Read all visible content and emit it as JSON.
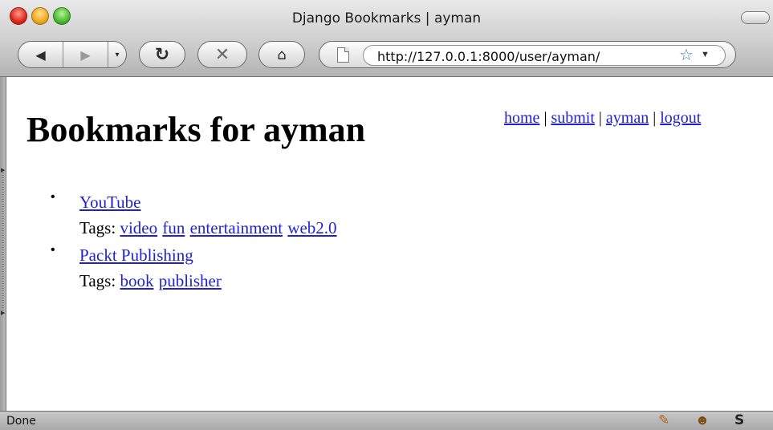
{
  "window": {
    "title": "Django Bookmarks | ayman"
  },
  "toolbar": {
    "back_icon": "◀",
    "forward_icon": "▶",
    "history_icon": "▾",
    "reload_icon": "↻",
    "stop_icon": "✕",
    "home_icon": "⌂",
    "url": "http://127.0.0.1:8000/user/ayman/",
    "star_icon": "☆",
    "dropdown_icon": "▼"
  },
  "page": {
    "title": "Bookmarks for ayman",
    "nav": {
      "home": "home",
      "submit": "submit",
      "user": "ayman",
      "logout": "logout",
      "separator": "|"
    },
    "bookmarks": [
      {
        "title": "YouTube",
        "tags_label": "Tags:",
        "tags": [
          "video",
          "fun",
          "entertainment",
          "web2.0"
        ]
      },
      {
        "title": "Packt Publishing",
        "tags_label": "Tags:",
        "tags": [
          "book",
          "publisher"
        ]
      }
    ]
  },
  "statusbar": {
    "text": "Done",
    "icons": [
      "firebug-icon",
      "greasemonkey-icon",
      "stumbleupon-icon"
    ]
  },
  "colors": {
    "link": "#1f1fd6",
    "close": "#e0261b",
    "minimize": "#f0a821",
    "zoom": "#4dba30"
  }
}
